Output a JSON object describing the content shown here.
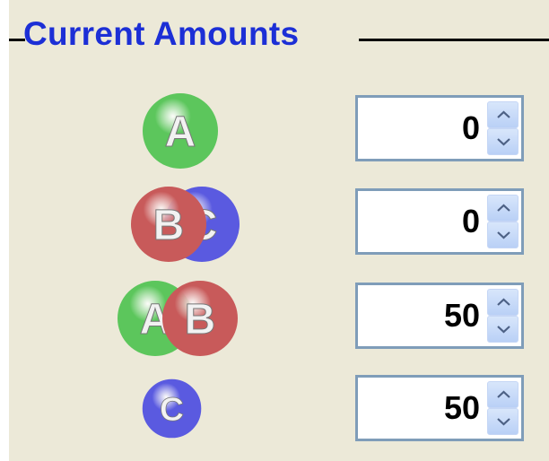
{
  "group": {
    "title": "Current Amounts"
  },
  "rows": [
    {
      "species": "A",
      "balls": [
        "A"
      ],
      "value": "0"
    },
    {
      "species": "BC",
      "balls": [
        "B",
        "C"
      ],
      "value": "0"
    },
    {
      "species": "AB",
      "balls": [
        "A",
        "B"
      ],
      "value": "50"
    },
    {
      "species": "C",
      "balls": [
        "C"
      ],
      "value": "50"
    }
  ],
  "ball_colors": {
    "A": "#5cc65c",
    "B": "#c85a5a",
    "C": "#5a5ae0"
  },
  "icons": {
    "increment": "chevron-up-icon",
    "decrement": "chevron-down-icon"
  }
}
